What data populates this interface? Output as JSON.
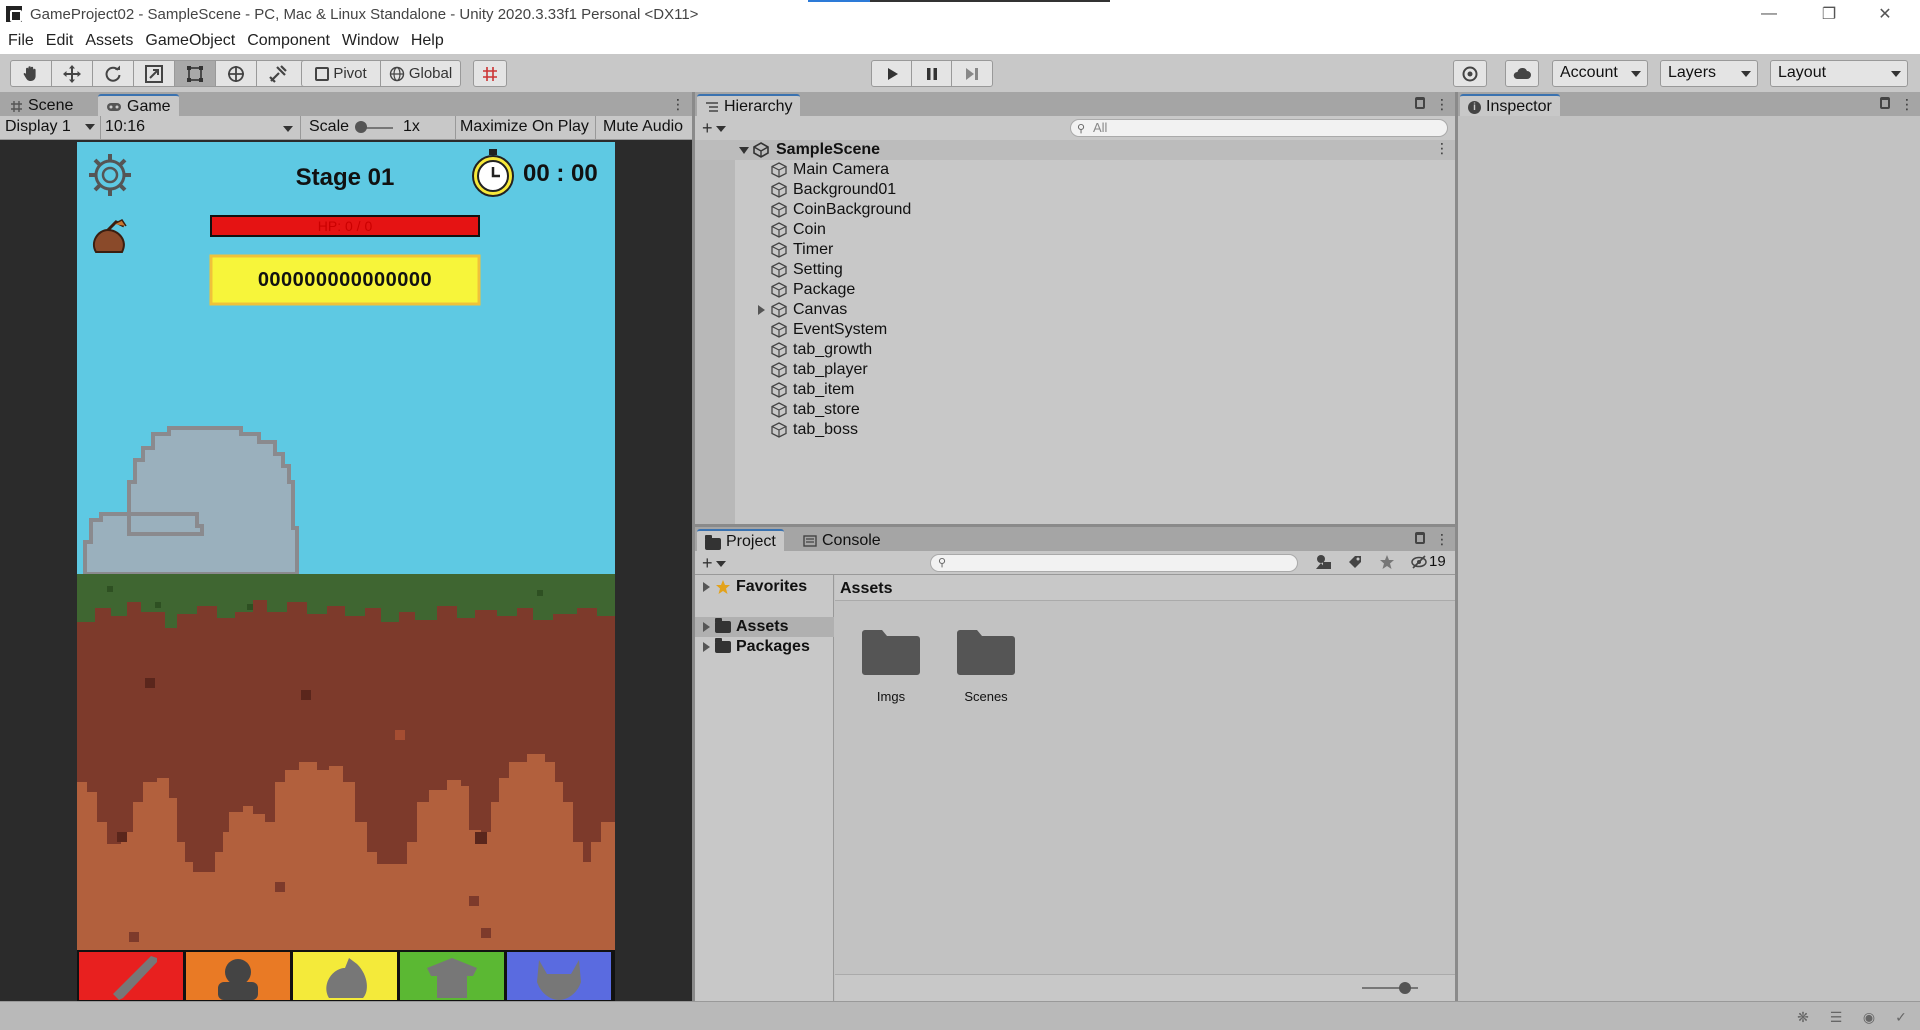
{
  "window": {
    "title": "GameProject02 - SampleScene - PC, Mac & Linux Standalone - Unity 2020.3.33f1 Personal <DX11>",
    "controls": [
      "minimize",
      "restore",
      "close"
    ]
  },
  "menu": [
    "File",
    "Edit",
    "Assets",
    "GameObject",
    "Component",
    "Window",
    "Help"
  ],
  "toolbar": {
    "tools": [
      "hand-tool",
      "move-tool",
      "rotate-tool",
      "scale-tool",
      "rect-tool",
      "transform-tool",
      "custom-tool"
    ],
    "active_tool": "rect-tool",
    "pivot_label": "Pivot",
    "global_label": "Global",
    "play_controls": [
      "play",
      "pause",
      "step"
    ],
    "account_label": "Account",
    "layers_label": "Layers",
    "layout_label": "Layout"
  },
  "game_panel": {
    "tabs": [
      {
        "label": "Scene",
        "active": false
      },
      {
        "label": "Game",
        "active": true
      }
    ],
    "display_label": "Display 1",
    "aspect_label": "10:16",
    "scale_label": "Scale",
    "scale_value": "1x",
    "maximize_label": "Maximize On Play",
    "mute_label": "Mute Audio"
  },
  "game": {
    "stage_label": "Stage 01",
    "timer_text": "00 : 00",
    "hp_text": "HP: 0 / 0",
    "coin_text": "000000000000000",
    "bottom_tabs": [
      {
        "name": "tab-growth",
        "color": "#e8201f",
        "icon": "sword-icon"
      },
      {
        "name": "tab-player",
        "color": "#e97a25",
        "icon": "player-icon"
      },
      {
        "name": "tab-item",
        "color": "#f4ea3a",
        "icon": "bag-icon"
      },
      {
        "name": "tab-store",
        "color": "#5bb833",
        "icon": "store-icon"
      },
      {
        "name": "tab-boss",
        "color": "#5a6be0",
        "icon": "boss-icon"
      }
    ],
    "colors": {
      "sky": "#5ec9e3",
      "grass": "#3f6631",
      "dirt": "#7d3a2b",
      "soil": "#b2603d",
      "rock": "#9ab0bd"
    }
  },
  "hierarchy": {
    "tab_label": "Hierarchy",
    "search_placeholder": "All",
    "scene_name": "SampleScene",
    "items": [
      {
        "label": "Main Camera",
        "expandable": false
      },
      {
        "label": "Background01",
        "expandable": false
      },
      {
        "label": "CoinBackground",
        "expandable": false
      },
      {
        "label": "Coin",
        "expandable": false
      },
      {
        "label": "Timer",
        "expandable": false
      },
      {
        "label": "Setting",
        "expandable": false
      },
      {
        "label": "Package",
        "expandable": false
      },
      {
        "label": "Canvas",
        "expandable": true
      },
      {
        "label": "EventSystem",
        "expandable": false
      },
      {
        "label": "tab_growth",
        "expandable": false
      },
      {
        "label": "tab_player",
        "expandable": false
      },
      {
        "label": "tab_item",
        "expandable": false
      },
      {
        "label": "tab_store",
        "expandable": false
      },
      {
        "label": "tab_boss",
        "expandable": false
      }
    ]
  },
  "project": {
    "tabs": [
      {
        "label": "Project",
        "active": true
      },
      {
        "label": "Console",
        "active": false
      }
    ],
    "hidden_count": "19",
    "tree": [
      {
        "label": "Favorites",
        "icon": "star-icon"
      },
      {
        "label": "Assets",
        "icon": "folder-icon",
        "selected": true
      },
      {
        "label": "Packages",
        "icon": "folder-icon"
      }
    ],
    "breadcrumb": "Assets",
    "folders": [
      "Imgs",
      "Scenes"
    ]
  },
  "inspector": {
    "tab_label": "Inspector"
  }
}
